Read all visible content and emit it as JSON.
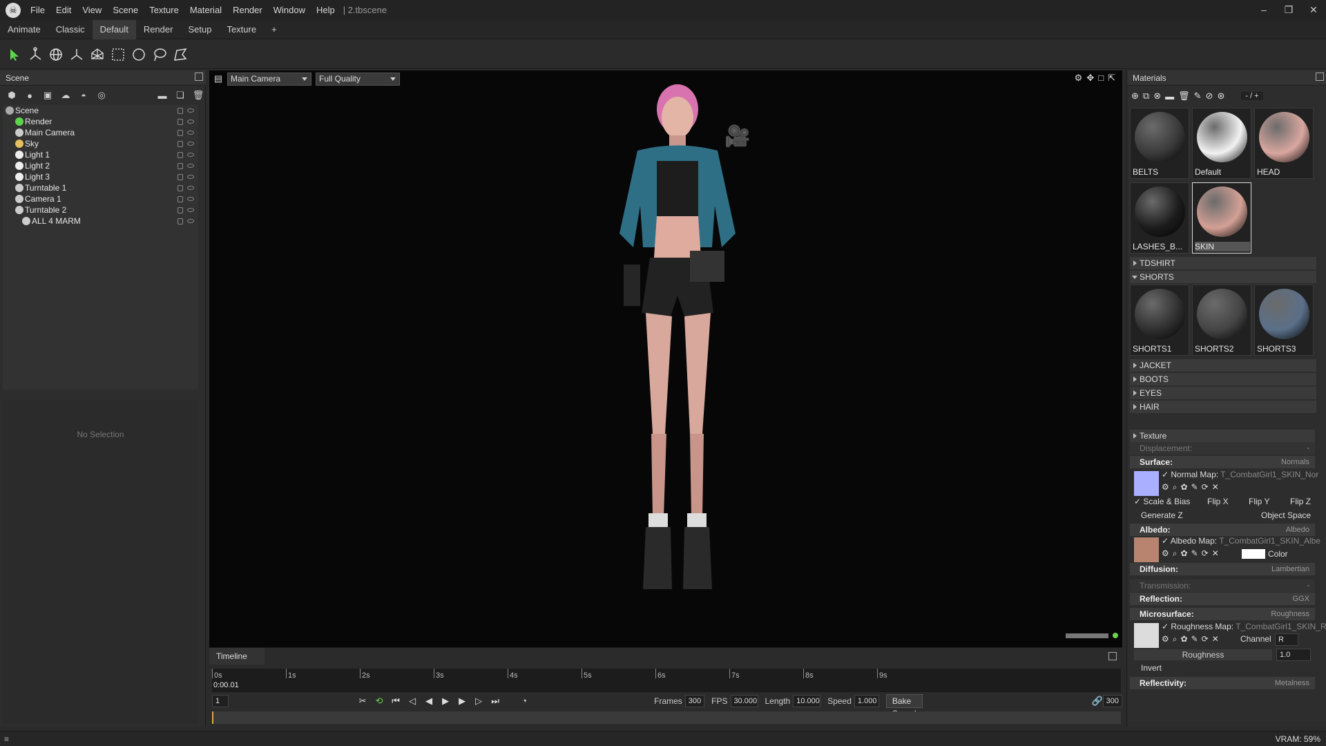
{
  "app": {
    "logo_icon": "skull-icon",
    "doc_name": "| 2.tbscene"
  },
  "menu": [
    "File",
    "Edit",
    "View",
    "Scene",
    "Texture",
    "Material",
    "Render",
    "Window",
    "Help"
  ],
  "window_controls": [
    "–",
    "❐",
    "✕"
  ],
  "layout_tabs": {
    "items": [
      "Animate",
      "Classic",
      "Default",
      "Render",
      "Setup",
      "Texture",
      "+"
    ],
    "active": "Default"
  },
  "tools": [
    "select-arrow-icon",
    "transform-icon",
    "rotate-globe-icon",
    "axis-icon",
    "mesh-icon",
    "rect-select-icon",
    "circle-select-icon",
    "lasso-icon",
    "paint-select-icon"
  ],
  "scene": {
    "title": "Scene",
    "tree": [
      {
        "label": "Scene",
        "icon": "scene-icon",
        "indent": 0
      },
      {
        "label": "Render",
        "icon": "render-icon",
        "indent": 1
      },
      {
        "label": "Main Camera",
        "icon": "camera-icon",
        "indent": 1
      },
      {
        "label": "Sky",
        "icon": "sky-icon",
        "indent": 1
      },
      {
        "label": "Light 1",
        "icon": "light-icon",
        "indent": 1
      },
      {
        "label": "Light 2",
        "icon": "light-icon",
        "indent": 1
      },
      {
        "label": "Light 3",
        "icon": "light-icon",
        "indent": 1
      },
      {
        "label": "Turntable 1",
        "icon": "turntable-icon",
        "indent": 1
      },
      {
        "label": "Camera 1",
        "icon": "camera-icon",
        "indent": 1
      },
      {
        "label": "Turntable 2",
        "icon": "turntable-icon",
        "indent": 1
      },
      {
        "label": "ALL 4 MARM",
        "icon": "mesh-icon",
        "indent": 2
      }
    ],
    "no_selection": "No Selection"
  },
  "viewport": {
    "camera": "Main Camera",
    "quality": "Full Quality"
  },
  "timeline": {
    "title": "Timeline",
    "ticks": [
      "0s",
      "1s",
      "2s",
      "3s",
      "4s",
      "5s",
      "6s",
      "7s",
      "8s",
      "9s"
    ],
    "current_time": "0:00.01",
    "frame": "1",
    "frames_label": "Frames",
    "frames": "300",
    "fps_label": "FPS",
    "fps": "30.000",
    "length_label": "Length",
    "length": "10.000",
    "speed_label": "Speed",
    "speed": "1.000",
    "bake_label": "Bake Speed",
    "end_frame": "300"
  },
  "materials": {
    "title": "Materials",
    "counter": "- / +",
    "top": [
      {
        "name": "BELTS",
        "color": "#3a3a3a"
      },
      {
        "name": "Default",
        "color": "#f2f2f2"
      },
      {
        "name": "HEAD",
        "color": "#d9a79f"
      },
      {
        "name": "LASHES_B...",
        "color": "#1c1c1c"
      },
      {
        "name": "SKIN",
        "color": "#d3a095"
      }
    ],
    "groups_a": [
      "TDSHIRT",
      "SHORTS"
    ],
    "shorts": [
      {
        "name": "SHORTS1",
        "color": "#2f2f2f"
      },
      {
        "name": "SHORTS2",
        "color": "#444"
      },
      {
        "name": "SHORTS3",
        "color": "#5a6f88"
      }
    ],
    "groups_b": [
      "JACKET",
      "BOOTS",
      "EYES",
      "HAIR"
    ]
  },
  "props": {
    "texture": "Texture",
    "displacement": {
      "label": "Displacement:",
      "value": "-"
    },
    "surface": {
      "label": "Surface:",
      "value": "Normals"
    },
    "normal_map": "Normal Map:",
    "normal_file": "T_CombatGirl1_SKIN_Nor",
    "scale_bias": "Scale & Bias",
    "flip_x": "Flip X",
    "flip_y": "Flip Y",
    "flip_z": "Flip Z",
    "generate_z": "Generate Z",
    "object_space": "Object Space",
    "albedo": {
      "label": "Albedo:",
      "value": "Albedo"
    },
    "albedo_map": "Albedo Map:",
    "albedo_file": "T_CombatGirl1_SKIN_Albe",
    "color": "Color",
    "diffusion": {
      "label": "Diffusion:",
      "value": "Lambertian"
    },
    "transmission": {
      "label": "Transmission:",
      "value": "-"
    },
    "reflection": {
      "label": "Reflection:",
      "value": "GGX"
    },
    "microsurface": {
      "label": "Microsurface:",
      "value": "Roughness"
    },
    "roughness_map": "Roughness Map:",
    "roughness_file": "T_CombatGirl1_SKIN_R",
    "channel": "Channel",
    "channel_value": "R",
    "roughness": "Roughness",
    "roughness_value": "1.0",
    "invert": "Invert",
    "reflectivity": {
      "label": "Reflectivity:",
      "value": "Metalness"
    }
  },
  "status": {
    "vram": "VRAM: 59%"
  }
}
